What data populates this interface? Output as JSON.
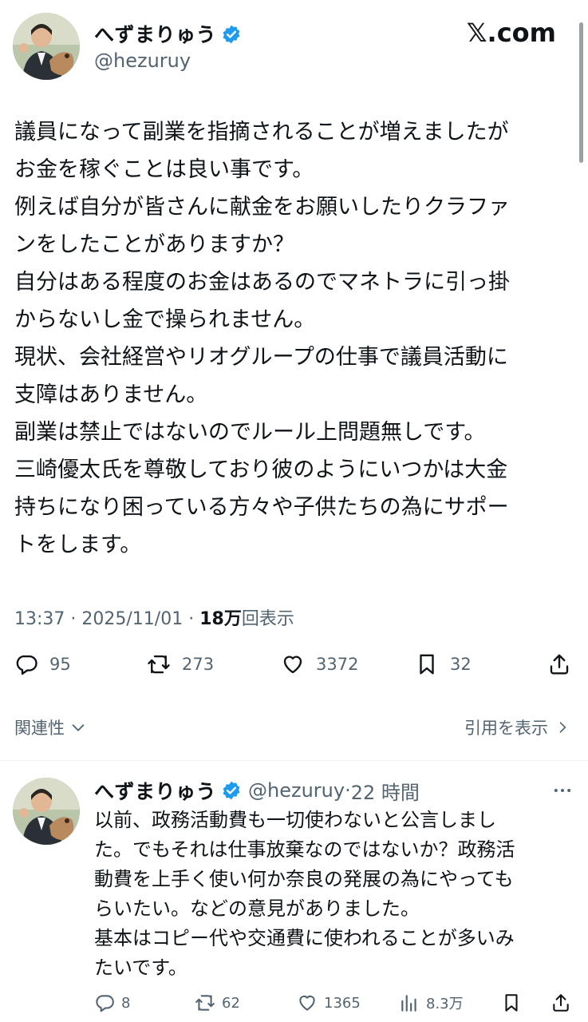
{
  "tweet": {
    "author_name": "へずまりゅう",
    "author_handle": "@hezuruy",
    "brand": "𝕏.com",
    "body": "議員になって副業を指摘されることが増えましたが\nお金を稼ぐことは良い事です。\n例えば自分が皆さんに献金をお願いしたりクラファ\nンをしたことがありますか？\n自分はある程度のお金はあるのでマネトラに引っ掛\nからないし金で操られません。\n現状、会社経営やリオグループの仕事で議員活動に\n支障はありません。\n副業は禁止ではないのでルール上問題無しです。\n三崎優太氏を尊敬しており彼のようにいつかは大金\n持ちになり困っている方々や子供たちの為にサポー\nトをします。",
    "time": "13:37",
    "date": "2025/11/01",
    "views_count": "18万",
    "views_label": "回表示",
    "replies": "95",
    "retweets": "273",
    "likes": "3372",
    "bookmarks": "32",
    "related_label": "関連性",
    "quotes_label": "引用を表示"
  },
  "reply": {
    "author_name": "へずまりゅう",
    "author_handle": "@hezuruy",
    "time_ago": "22 時間",
    "body": "以前、政務活動費も一切使わないと公言しまし\nた。でもそれは仕事放棄なのではないか？政務活\n動費を上手く使い何か奈良の発展の為にやっても\nらいたい。などの意見がありました。\n基本はコピー代や交通費に使われることが多いみ\nたいです。",
    "replies": "8",
    "retweets": "62",
    "likes": "1365",
    "views": "8.3万"
  },
  "colors": {
    "verified": "#1d9bf0",
    "text": "#0f1419",
    "secondary": "#536471"
  },
  "icons": [
    "verified-badge-icon",
    "reply-icon",
    "retweet-icon",
    "like-icon",
    "bookmark-icon",
    "share-icon",
    "views-icon",
    "more-icon",
    "chevron-down-icon",
    "chevron-right-icon"
  ]
}
